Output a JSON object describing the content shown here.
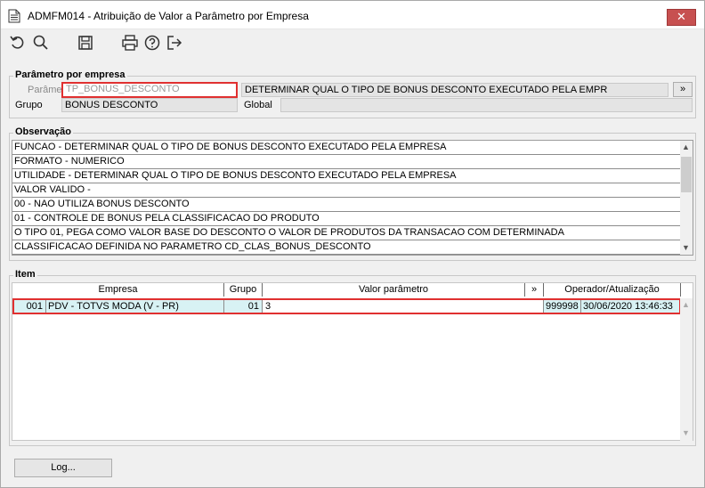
{
  "window": {
    "title": "ADMFM014 - Atribuição de Valor a Parâmetro por Empresa",
    "close_label": "✕"
  },
  "toolbar": {
    "icons": [
      "undo-icon",
      "search-icon",
      "save-icon",
      "print-icon",
      "help-icon",
      "exit-icon"
    ]
  },
  "parametro_section": {
    "title": "Parâmetro por empresa",
    "parametro_label": "Parâmetro",
    "parametro_value": "TP_BONUS_DESCONTO",
    "descricao_value": "DETERMINAR QUAL O TIPO DE BONUS DESCONTO EXECUTADO PELA EMPR",
    "expand_label": "»",
    "grupo_label": "Grupo",
    "grupo_value": "BONUS DESCONTO",
    "global_label": "Global",
    "global_value": ""
  },
  "observacao": {
    "title": "Observação",
    "lines": [
      "FUNCAO - DETERMINAR QUAL O TIPO DE BONUS DESCONTO EXECUTADO PELA EMPRESA",
      "FORMATO - NUMERICO",
      "UTILIDADE - DETERMINAR QUAL O TIPO DE BONUS DESCONTO EXECUTADO PELA EMPRESA",
      "VALOR VALIDO -",
      "00 -  NAO UTILIZA BONUS DESCONTO",
      "01 - CONTROLE DE BONUS PELA CLASSIFICACAO DO PRODUTO",
      " O TIPO 01, PEGA COMO VALOR BASE DO DESCONTO O VALOR DE PRODUTOS DA TRANSACAO COM DETERMINADA",
      " CLASSIFICACAO DEFINIDA NO PARAMETRO CD_CLAS_BONUS_DESCONTO"
    ]
  },
  "item": {
    "title": "Item",
    "headers": {
      "empresa": "Empresa",
      "grupo": "Grupo",
      "valor": "Valor parâmetro",
      "expand": "»",
      "operador": "Operador/Atualização"
    },
    "rows": [
      {
        "codigo": "001",
        "empresa": "PDV - TOTVS MODA (V - PR)",
        "grupo": "01",
        "valor": "3",
        "operador": "999998",
        "atualizacao": "30/06/2020 13:46:33"
      }
    ]
  },
  "footer": {
    "log_label": "Log..."
  }
}
